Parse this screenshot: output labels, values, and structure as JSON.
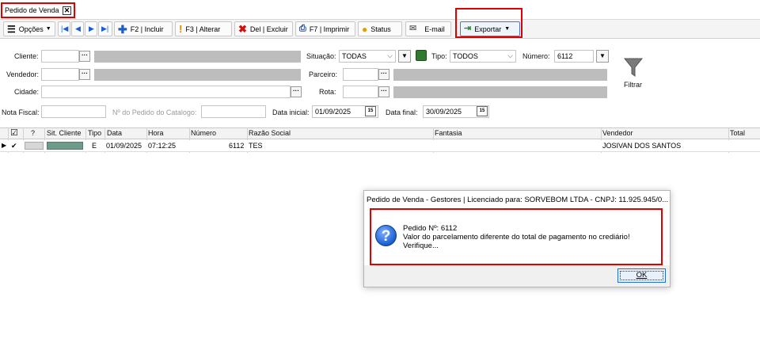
{
  "tab": {
    "label": "Pedido de Venda",
    "close": "✕"
  },
  "toolbar": {
    "opcoes": "Opções",
    "incluir": "F2 | Incluir",
    "alterar": "F3 | Alterar",
    "excluir": "Del | Excluir",
    "imprimir": "F7 | Imprimir",
    "status": "Status",
    "email": "E-mail",
    "exportar": "Exportar"
  },
  "filters": {
    "cliente_label": "Cliente:",
    "vendedor_label": "Vendedor:",
    "cidade_label": "Cidade:",
    "nota_fiscal_label": "Nota Fiscal:",
    "pedido_catalogo_label": "Nº do Pedido do Catalogo:",
    "situacao_label": "Situação:",
    "situacao_value": "TODAS",
    "tipo_label": "Tipo:",
    "tipo_value": "TODOS",
    "numero_label": "Número:",
    "numero_value": "6112",
    "parceiro_label": "Parceiro:",
    "rota_label": "Rota:",
    "data_inicial_label": "Data inicial:",
    "data_inicial_value": "01/09/2025",
    "data_final_label": "Data final:",
    "data_final_value": "30/09/2025",
    "filtrar_label": "Filtrar"
  },
  "grid": {
    "headers": {
      "check": "☑",
      "q": "?",
      "sit_cliente": "Sit. Cliente",
      "tipo": "Tipo",
      "data": "Data",
      "hora": "Hora",
      "numero": "Número",
      "razao_social": "Razão Social",
      "fantasia": "Fantasia",
      "vendedor": "Vendedor",
      "total": "Total"
    },
    "row": {
      "check": "✔",
      "tipo": "E",
      "data": "01/09/2025",
      "hora": "07:12:25",
      "numero": "6112",
      "razao_social": "TES",
      "fantasia": "",
      "vendedor": "JOSIVAN DOS SANTOS",
      "sit_color": "#6e9a8a"
    }
  },
  "dialog": {
    "title": "Pedido de Venda - Gestores | Licenciado para: SORVEBOM LTDA - CNPJ: 11.925.945/0...",
    "line1": "Pedido Nº: 6112",
    "line2": "Valor do parcelamento diferente do total de pagamento no crediário!",
    "line3": "Verifique...",
    "ok": "OK"
  },
  "colors": {
    "highlight": "#e00000",
    "disabled_field": "#bdbdbd"
  }
}
